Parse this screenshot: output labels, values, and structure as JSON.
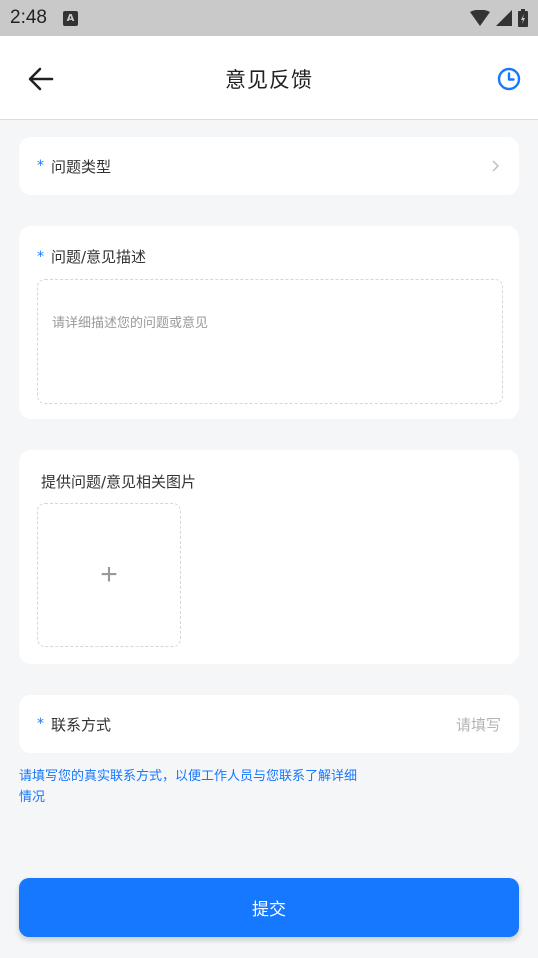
{
  "status_bar": {
    "time": "2:48",
    "notification_badge": "A"
  },
  "header": {
    "title": "意见反馈",
    "back_icon": "arrow-left-icon",
    "history_icon": "clock-icon"
  },
  "form": {
    "required_mark": "*",
    "problem_type": {
      "label": "问题类型"
    },
    "description": {
      "label": "问题/意见描述",
      "placeholder": "请详细描述您的问题或意见"
    },
    "images": {
      "label": "提供问题/意见相关图片",
      "add_symbol": "+"
    },
    "contact": {
      "label": "联系方式",
      "placeholder": "请填写"
    },
    "hint": "请填写您的真实联系方式，以便工作人员与您联系了解详细情况"
  },
  "submit_label": "提交",
  "colors": {
    "accent": "#1677ff",
    "background": "#f5f6f8"
  }
}
